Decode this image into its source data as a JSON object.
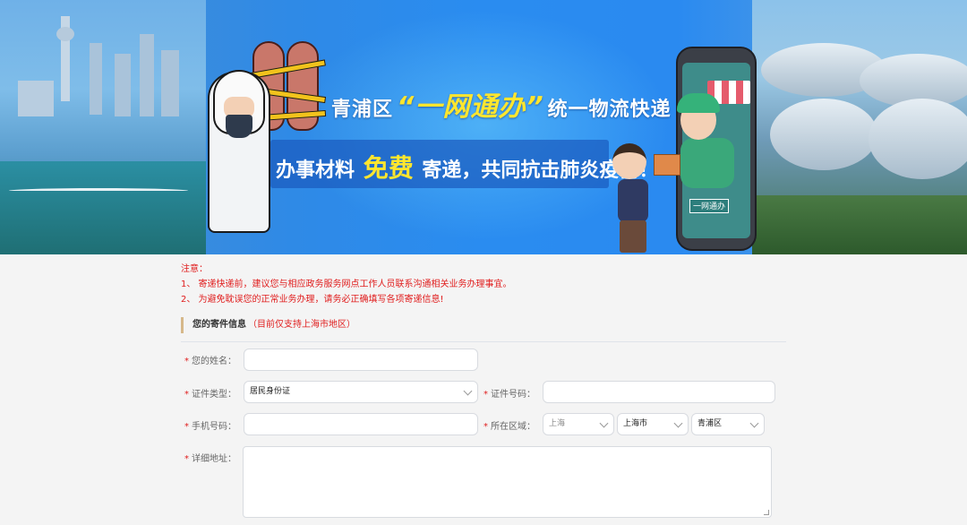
{
  "banner": {
    "headline_prefix": "青浦区",
    "headline_highlight": "“一网通办”",
    "headline_suffix": "统一物流快递",
    "slogan_prefix": "办事材料",
    "slogan_free": "免费",
    "slogan_suffix": "寄递，共同抗击肺炎疫情！",
    "phone_sign": "一网通办"
  },
  "notice": {
    "title": "注意：",
    "items": [
      "1、 寄递快递前，建议您与相应政务服务网点工作人员联系沟通相关业务办理事宜。",
      "2、 为避免耽误您的正常业务办理，请务必正确填写各项寄递信息!"
    ]
  },
  "section": {
    "title": "您的寄件信息",
    "note": "（目前仅支持上海市地区）"
  },
  "form": {
    "required_mark": "*",
    "name_label": "您的姓名：",
    "name_value": "",
    "id_type_label": "证件类型：",
    "id_type_value": "居民身份证",
    "id_number_label": "证件号码：",
    "id_number_value": "",
    "phone_label": "手机号码：",
    "phone_value": "",
    "region_label": "所在区域：",
    "province_value": "上海",
    "city_value": "上海市",
    "district_value": "青浦区",
    "address_label": "详细地址："
  },
  "colors": {
    "notice_red": "#e01d1d",
    "banner_blue": "#2a8cf0",
    "highlight_yellow": "#ffe62e"
  }
}
